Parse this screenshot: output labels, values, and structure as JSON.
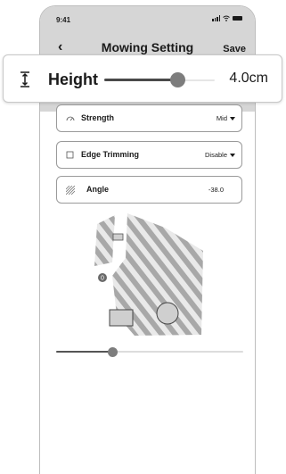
{
  "status_bar": {
    "time": "9:41"
  },
  "nav": {
    "back": "‹",
    "title": "Mowing Setting",
    "save": "Save"
  },
  "height": {
    "label": "Height",
    "value": "4.0cm",
    "slider_fraction": 0.66
  },
  "settings": {
    "strength": {
      "label": "Strength",
      "value": "Mid"
    },
    "edge_trimming": {
      "label": "Edge Trimming",
      "value": "Disable"
    },
    "angle": {
      "label": "Angle",
      "value": "-38.0"
    }
  },
  "bottom_slider": {
    "fraction": 0.3
  },
  "map": {
    "marker_label": "0"
  },
  "colors": {
    "header_bg": "#d6d6d6",
    "stripe": "#a8a8a8",
    "slider_thumb": "#7d7d7d"
  },
  "icons": [
    "height-icon",
    "gauge-icon",
    "checkbox-icon",
    "hatch-icon",
    "chevron-left-icon"
  ]
}
